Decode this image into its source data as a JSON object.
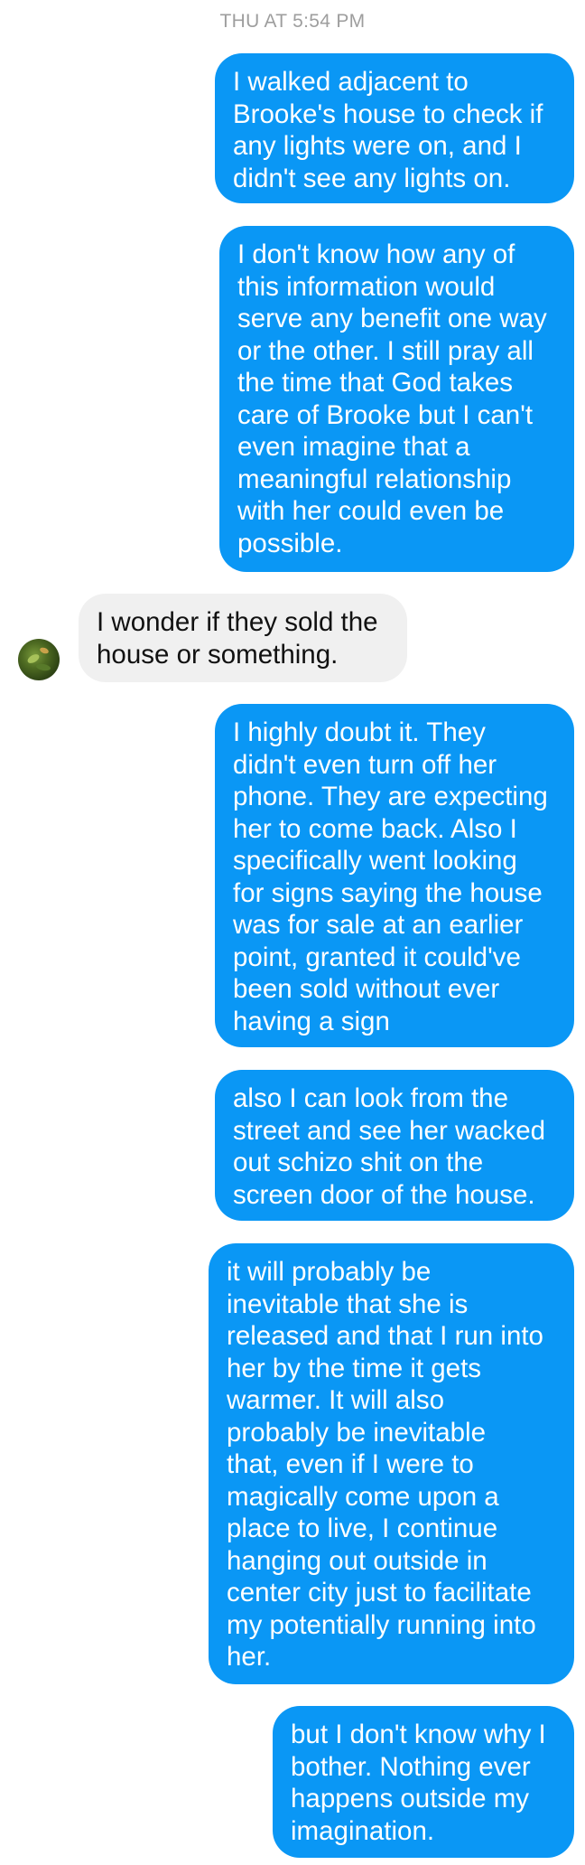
{
  "thread": {
    "timestamp": "THU AT 5:54 PM",
    "messages": [
      {
        "sender": "me",
        "text": "I walked adjacent to\nBrooke's house to check if\nany lights were on, and I\ndidn't see any lights on."
      },
      {
        "sender": "me",
        "text": "I don't know how any of\nthis information would\nserve any benefit one way\nor the other. I still pray all\nthe time that God takes\ncare of Brooke but I can't\neven imagine that a\nmeaningful relationship\nwith her could even be\npossible."
      },
      {
        "sender": "them",
        "text": "I wonder if they sold the\nhouse or something.",
        "avatar_icon": "contact-avatar-icon"
      },
      {
        "sender": "me",
        "text": "I highly doubt it. They\ndidn't even turn off her\nphone. They are expecting\nher to come back. Also I\nspecifically went looking\nfor signs saying the house\nwas for sale at an earlier\npoint, granted it could've\nbeen sold without ever\nhaving a sign"
      },
      {
        "sender": "me",
        "text": "also I can look from the\nstreet and see her wacked\nout schizo shit on the\nscreen door of the house."
      },
      {
        "sender": "me",
        "text": "it will probably be\ninevitable that she is\nreleased and that I run into\nher by the time it gets\nwarmer. It will also\nprobably be inevitable\nthat, even if I were to\nmagically come upon a\nplace to live, I continue\nhanging out outside in\ncenter city just to facilitate\nmy potentially running into\nher."
      },
      {
        "sender": "me",
        "text": "but I don't know why I\nbother. Nothing ever\nhappens outside my\nimagination."
      }
    ]
  },
  "colors": {
    "outgoing_bubble": "#0a97f5",
    "incoming_bubble": "#f0f0f0",
    "timestamp_text": "#9e9e9e"
  }
}
